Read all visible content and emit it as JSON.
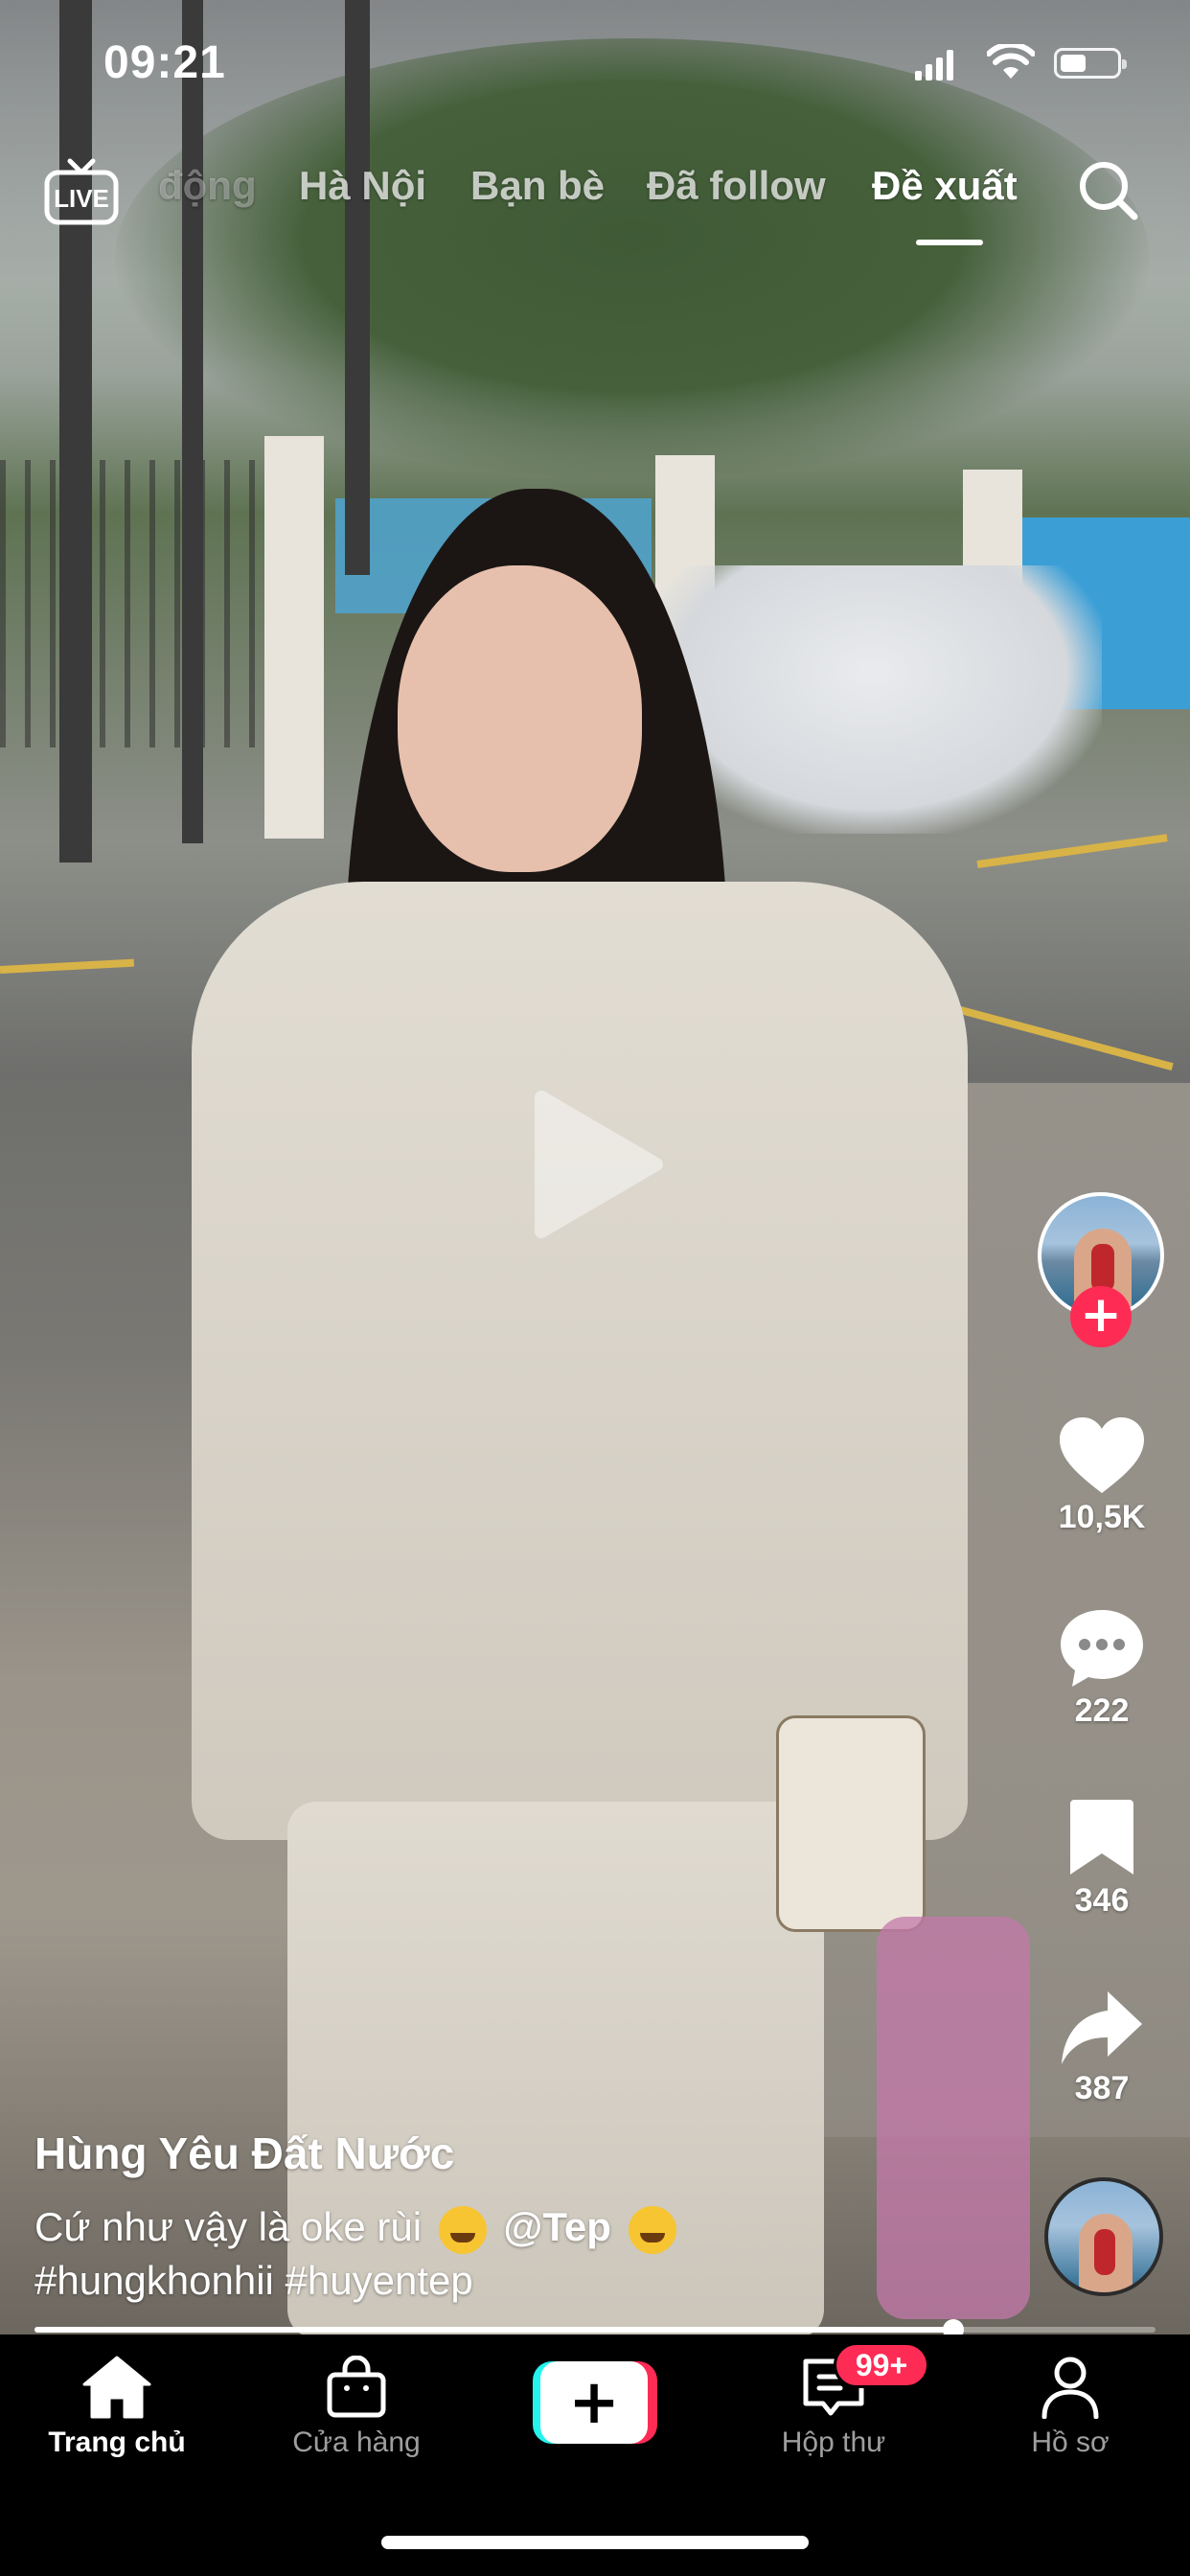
{
  "status_bar": {
    "time": "09:21"
  },
  "top_nav": {
    "live_label": "LIVE",
    "tabs": [
      {
        "label": "động",
        "state": "faded"
      },
      {
        "label": "Hà Nội",
        "state": "inactive"
      },
      {
        "label": "Bạn bè",
        "state": "inactive"
      },
      {
        "label": "Đã follow",
        "state": "inactive"
      },
      {
        "label": "Đề xuất",
        "state": "active"
      }
    ]
  },
  "actions": {
    "follow_symbol": "+",
    "likes": "10,5K",
    "comments": "222",
    "saves": "346",
    "shares": "387"
  },
  "video": {
    "author": "Hùng Yêu Đất Nước",
    "caption_text": "Cứ như vậy là oke rùi",
    "mention": "@Tep",
    "hashtags": "#hungkhonhii #huyentep",
    "progress_fraction": 0.82
  },
  "tab_bar": {
    "items": [
      {
        "label": "Trang chủ",
        "icon": "home-icon",
        "active": true
      },
      {
        "label": "Cửa hàng",
        "icon": "shop-bag-icon",
        "active": false
      },
      {
        "label": "",
        "icon": "create-plus-icon",
        "active": false
      },
      {
        "label": "Hộp thư",
        "icon": "inbox-icon",
        "active": false
      },
      {
        "label": "Hồ sơ",
        "icon": "profile-icon",
        "active": false
      }
    ],
    "inbox_badge": "99+",
    "create_symbol": "+"
  },
  "colors": {
    "accent": "#fe2c55",
    "cyan": "#25f4ee",
    "bar": "#000000"
  }
}
